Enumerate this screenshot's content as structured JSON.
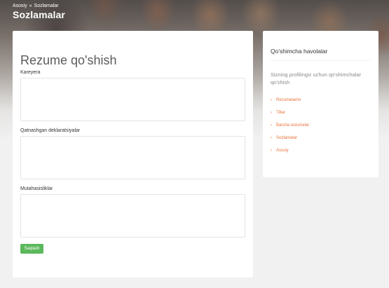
{
  "breadcrumb": {
    "home": "Asosiy",
    "separator": "»",
    "current": "Sozlamalar"
  },
  "page_title": "Sozlamalar",
  "form": {
    "title": "Rezume qo'shish",
    "fields": [
      {
        "label": "Kareyera",
        "value": ""
      },
      {
        "label": "Qatnashgan deklaratsiyalar",
        "value": ""
      },
      {
        "label": "Mutahasisliklar",
        "value": ""
      }
    ],
    "save_label": "Saqlash",
    "save_color": "#5cb85c"
  },
  "sidebar": {
    "title": "Qo'shimcha havolalar",
    "description": "Sizning profilingiz uchun qo'shimchalar qo'shish",
    "link_color": "#e8723a",
    "links": [
      {
        "label": "Rezumelarim"
      },
      {
        "label": "Tillar"
      },
      {
        "label": "Barcha rezumelar"
      },
      {
        "label": "Sozlamalar"
      },
      {
        "label": "Asosiy"
      }
    ]
  }
}
